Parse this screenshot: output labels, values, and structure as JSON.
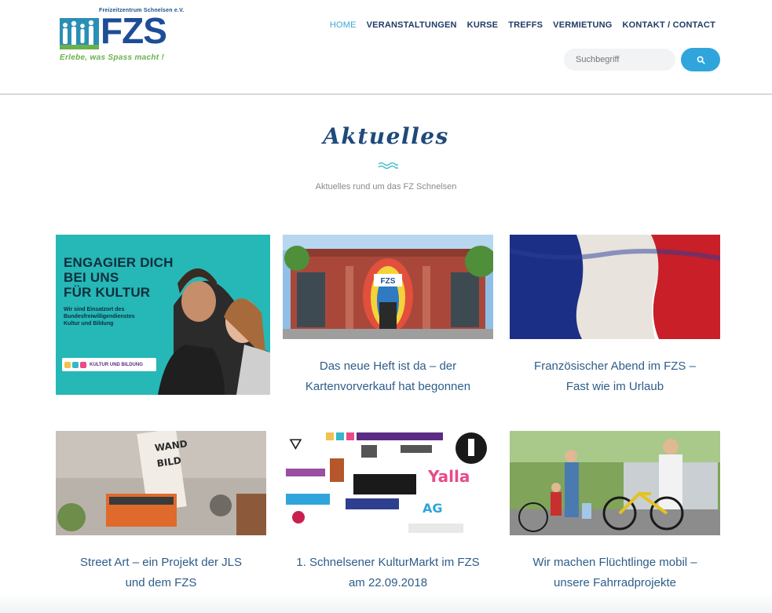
{
  "header": {
    "logo": {
      "org_name": "Freizeitzentrum Schnelsen e.V.",
      "wordmark": "FZS",
      "slogan": "Erlebe, was Spass macht !"
    },
    "nav": [
      {
        "label": "HOME",
        "active": true
      },
      {
        "label": "VERANSTALTUNGEN",
        "active": false
      },
      {
        "label": "KURSE",
        "active": false
      },
      {
        "label": "TREFFS",
        "active": false
      },
      {
        "label": "VERMIETUNG",
        "active": false
      },
      {
        "label": "KONTAKT / CONTACT",
        "active": false
      }
    ],
    "search": {
      "placeholder": "Suchbegriff",
      "button_icon": "search-icon"
    }
  },
  "section": {
    "title": "Aktuelles",
    "subtitle": "Aktuelles rund um das FZ Schnelsen"
  },
  "feature": {
    "heading_line1": "ENGAGIER DICH",
    "heading_line2": "BEI UNS",
    "heading_line3": "FÜR KULTUR",
    "sub_line1": "Wir sind Einsatzort des",
    "sub_line2": "Bundesfreiwilligendienstes",
    "sub_line3": "Kultur und Bildung",
    "badge": "KULTUR UND BILDUNG"
  },
  "posts": [
    {
      "caption_line1": "Das neue Heft ist da – der",
      "caption_line2": "Kartenvorverkauf hat begonnen"
    },
    {
      "caption_line1": "Französischer Abend im FZS –",
      "caption_line2": "Fast wie im Urlaub"
    },
    {
      "caption_line1": "Street Art – ein Projekt der JLS",
      "caption_line2": "und dem FZS"
    },
    {
      "caption_line1": "1. Schnelsener KulturMarkt im FZS",
      "caption_line2": "am 22.09.2018"
    },
    {
      "caption_line1": "Wir machen Flüchtlinge mobil –",
      "caption_line2": "unsere Fahrradprojekte"
    }
  ],
  "colors": {
    "nav_text": "#1f3b66",
    "nav_active": "#35a7d8",
    "accent": "#2fa5dc",
    "title": "#1f4a7a",
    "caption": "#2d5d8a"
  }
}
